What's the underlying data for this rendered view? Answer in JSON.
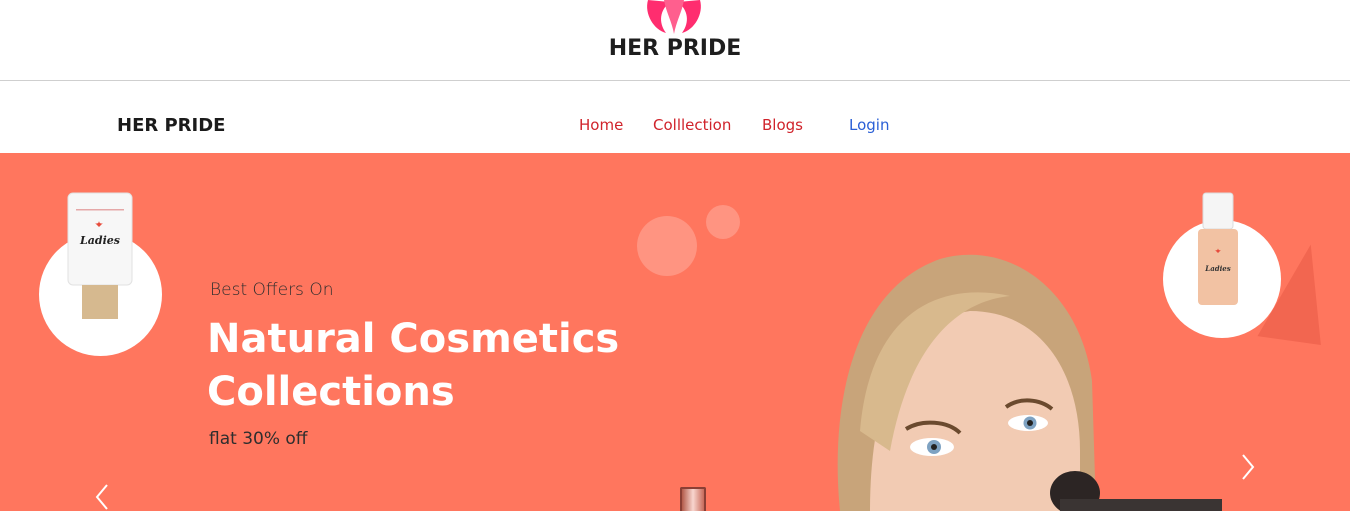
{
  "header": {
    "logo_text": "HER PRIDE"
  },
  "nav": {
    "brand": "HER PRIDE",
    "links": [
      {
        "label": "Home"
      },
      {
        "label": "Colllection"
      },
      {
        "label": "Blogs"
      },
      {
        "label": "Login"
      }
    ]
  },
  "hero": {
    "eyebrow": "Best Offers On",
    "headline": "Natural Cosmetics Collections",
    "subline": "flat 30% off",
    "products": [
      {
        "label": "Ladies"
      },
      {
        "label": "Ladies"
      }
    ],
    "background_color": "#ff765e"
  },
  "icons": {
    "logo": "woman-profile-logo-icon",
    "prev": "chevron-left-icon",
    "next": "chevron-right-icon"
  },
  "colors": {
    "nav_link": "#d0232b",
    "login_link": "#2a5fd6",
    "logo_accent": "#ff2d6f"
  }
}
